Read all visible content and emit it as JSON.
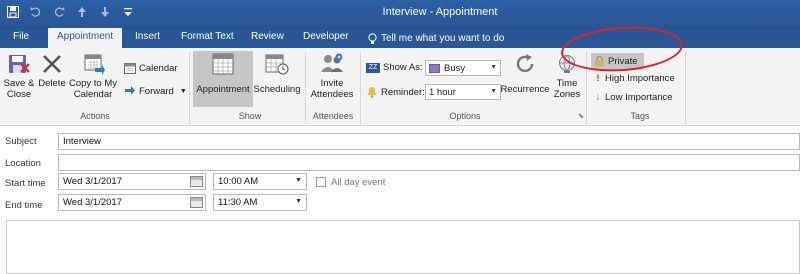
{
  "window": {
    "title": "Interview - Appointment"
  },
  "quick_access": [
    "save-icon",
    "undo-icon",
    "redo-icon",
    "up-arrow-icon",
    "down-arrow-icon",
    "customize-qat-icon"
  ],
  "tabs": [
    "File",
    "Appointment",
    "Insert",
    "Format Text",
    "Review",
    "Developer"
  ],
  "tell_me": "Tell me what you want to do",
  "ribbon": {
    "actions": {
      "label": "Actions",
      "save_close": [
        "Save &",
        "Close"
      ],
      "delete": "Delete",
      "copy_calendar": [
        "Copy to My",
        "Calendar"
      ],
      "calendar": "Calendar",
      "forward": "Forward"
    },
    "show": {
      "label": "Show",
      "appointment": "Appointment",
      "scheduling": "Scheduling"
    },
    "attendees": {
      "label": "Attendees",
      "invite": [
        "Invite",
        "Attendees"
      ]
    },
    "options": {
      "label": "Options",
      "show_as_label": "Show As:",
      "show_as_value": "Busy",
      "reminder_label": "Reminder:",
      "reminder_value": "1 hour",
      "recurrence": "Recurrence",
      "time_zones": [
        "Time",
        "Zones"
      ]
    },
    "tags": {
      "label": "Tags",
      "private": "Private",
      "high": "High Importance",
      "low": "Low Importance"
    }
  },
  "form": {
    "subject_label": "Subject",
    "subject_value": "Interview",
    "location_label": "Location",
    "location_value": "",
    "start_label": "Start time",
    "start_date": "Wed 3/1/2017",
    "start_time": "10:00 AM",
    "end_label": "End time",
    "end_date": "Wed 3/1/2017",
    "end_time": "11:30 AM",
    "all_day": "All day event"
  },
  "colors": {
    "accent": "#2b5797",
    "annotation": "#d8232a",
    "busy": "#8e78c5"
  }
}
